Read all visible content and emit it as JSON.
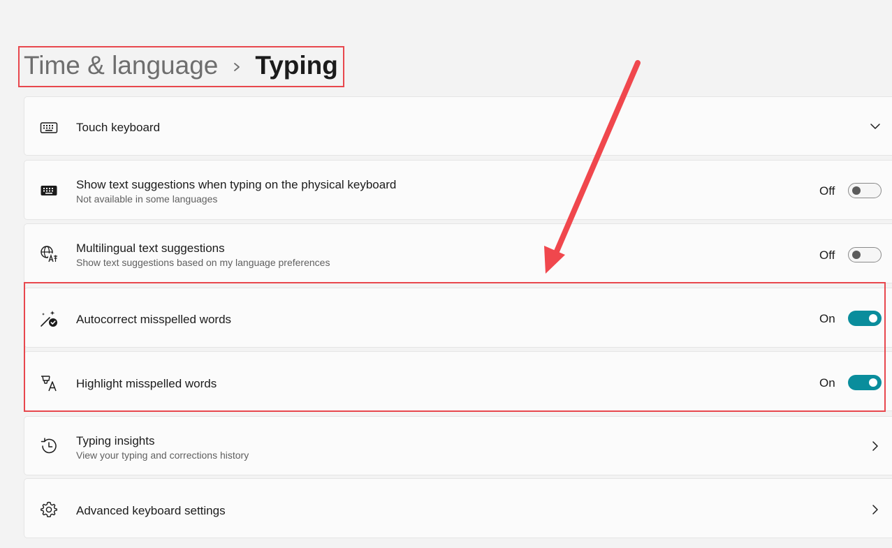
{
  "breadcrumb": {
    "parent": "Time & language",
    "separator_icon": "chevron-right-icon",
    "current": "Typing"
  },
  "annotations": {
    "color": "#e8474d",
    "breadcrumb_highlight": true,
    "rows_highlight": true,
    "arrow": true
  },
  "settings": [
    {
      "id": "touch-keyboard",
      "icon": "keyboard-outline-icon",
      "title": "Touch keyboard",
      "subtitle": "",
      "control": "expand",
      "control_icon": "chevron-down-icon"
    },
    {
      "id": "text-suggestions-physical",
      "icon": "keyboard-filled-icon",
      "title": "Show text suggestions when typing on the physical keyboard",
      "subtitle": "Not available in some languages",
      "control": "toggle",
      "state_label": "Off",
      "checked": false
    },
    {
      "id": "multilingual-suggestions",
      "icon": "globe-language-icon",
      "title": "Multilingual text suggestions",
      "subtitle": "Show text suggestions based on my language preferences",
      "control": "toggle",
      "state_label": "Off",
      "checked": false
    },
    {
      "id": "autocorrect",
      "icon": "magic-wand-check-icon",
      "title": "Autocorrect misspelled words",
      "subtitle": "",
      "control": "toggle",
      "state_label": "On",
      "checked": true
    },
    {
      "id": "highlight-misspelled",
      "icon": "text-highlight-icon",
      "title": "Highlight misspelled words",
      "subtitle": "",
      "control": "toggle",
      "state_label": "On",
      "checked": true
    },
    {
      "id": "typing-insights",
      "icon": "history-icon",
      "title": "Typing insights",
      "subtitle": "View your typing and corrections history",
      "control": "navigate",
      "control_icon": "chevron-right-icon"
    },
    {
      "id": "advanced-keyboard",
      "icon": "gear-icon",
      "title": "Advanced keyboard settings",
      "subtitle": "",
      "control": "navigate",
      "control_icon": "chevron-right-icon"
    }
  ],
  "colors": {
    "background": "#f3f3f3",
    "card": "#fbfbfb",
    "accent_toggle_on": "#0a8d9c",
    "annotation_red": "#e8474d"
  }
}
